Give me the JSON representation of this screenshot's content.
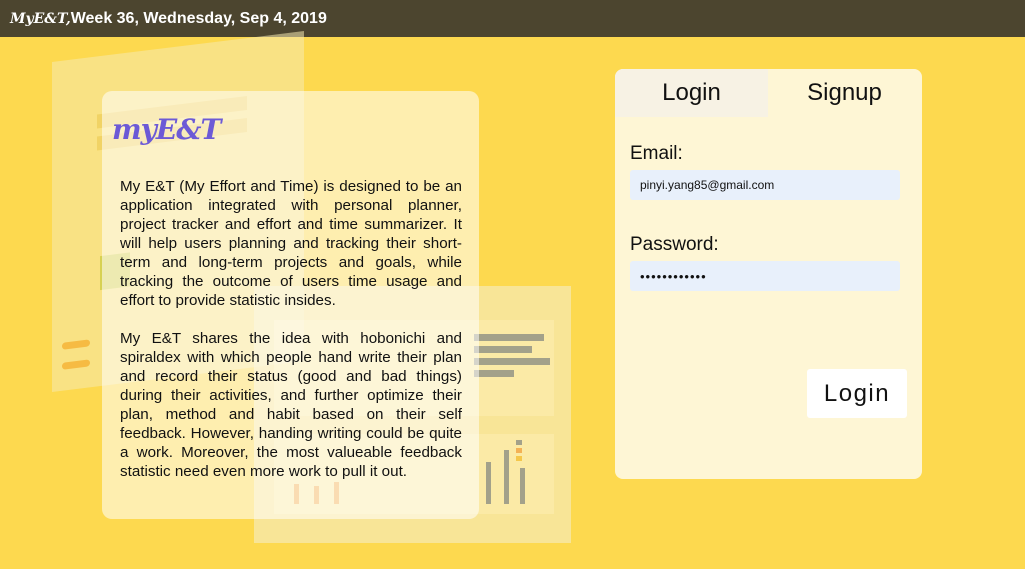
{
  "header": {
    "brand": "MyE&T,",
    "date_text": " Week 36, Wednesday, Sep 4, 2019"
  },
  "about": {
    "logo": "myE&T",
    "paragraphs": [
      "My E&T (My Effort and Time) is designed to be an application integrated with personal planner, project tracker and effort and time summarizer. It will help users planning and tracking their short-term and long-term projects and goals, while tracking the outcome of users time usage and effort to provide statistic insides.",
      "My E&T shares the idea with hobonichi and spiraldex with which people hand write their plan and record their status (good and bad things) during their activities, and further optimize their plan, method and habit based on their self feedback. However, handing writing could be quite a work. Moreover, the most valueable feedback statistic need even more work to pull it out."
    ]
  },
  "auth": {
    "tabs": [
      "Login",
      "Signup"
    ],
    "email_label": "Email:",
    "email_value": "pinyi.yang85@gmail.com",
    "password_label": "Password:",
    "password_value": "••••••••••••",
    "submit_label": "Login"
  },
  "colors": {
    "background": "#fdd94f",
    "topbar": "#4c452f",
    "logo": "#6c5ad6",
    "input_bg": "#e8f0fb"
  }
}
